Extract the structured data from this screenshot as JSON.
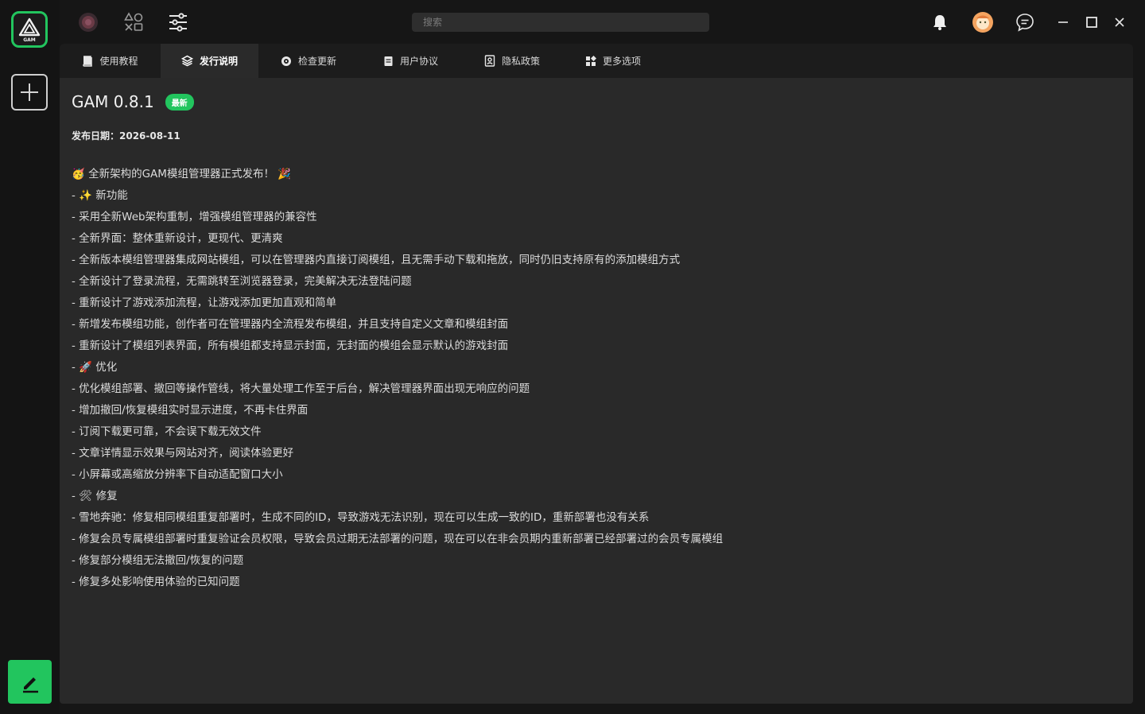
{
  "app": {
    "logo_text": "GAM"
  },
  "search": {
    "placeholder": "搜索"
  },
  "tabs": [
    {
      "label": "使用教程",
      "icon": "book-icon"
    },
    {
      "label": "发行说明",
      "icon": "layers-icon"
    },
    {
      "label": "检查更新",
      "icon": "refresh-icon"
    },
    {
      "label": "用户协议",
      "icon": "document-icon"
    },
    {
      "label": "隐私政策",
      "icon": "privacy-icon"
    },
    {
      "label": "更多选项",
      "icon": "grid-icon"
    }
  ],
  "active_tab": "发行说明",
  "release": {
    "title": "GAM 0.8.1",
    "badge": "最新",
    "date": "发布日期：2026-08-11",
    "notes": [
      "🥳 全新架构的GAM模组管理器正式发布！ 🎉",
      "- ✨ 新功能",
      "- 采用全新Web架构重制，增强模组管理器的兼容性",
      "- 全新界面：整体重新设计，更现代、更清爽",
      "- 全新版本模组管理器集成网站模组，可以在管理器内直接订阅模组，且无需手动下载和拖放，同时仍旧支持原有的添加模组方式",
      "- 全新设计了登录流程，无需跳转至浏览器登录，完美解决无法登陆问题",
      "- 重新设计了游戏添加流程，让游戏添加更加直观和简单",
      "- 新增发布模组功能，创作者可在管理器内全流程发布模组，并且支持自定义文章和模组封面",
      "- 重新设计了模组列表界面，所有模组都支持显示封面，无封面的模组会显示默认的游戏封面",
      "- 🚀 优化",
      "- 优化模组部署、撤回等操作管线，将大量处理工作至于后台，解决管理器界面出现无响应的问题",
      "- 增加撤回/恢复模组实时显示进度，不再卡住界面",
      "- 订阅下载更可靠，不会误下载无效文件",
      "- 文章详情显示效果与网站对齐，阅读体验更好",
      "- 小屏幕或高缩放分辨率下自动适配窗口大小",
      "- 🛠 修复",
      "- 雪地奔驰：修复相同模组重复部署时，生成不同的ID，导致游戏无法识别，现在可以生成一致的ID，重新部署也没有关系",
      "- 修复会员专属模组部署时重复验证会员权限，导致会员过期无法部署的问题，现在可以在非会员期内重新部署已经部署过的会员专属模组",
      "- 修复部分模组无法撤回/恢复的问题",
      "- 修复多处影响使用体验的已知问题"
    ]
  },
  "colors": {
    "accent": "#22c55e",
    "panel": "#292929",
    "background": "#161616"
  }
}
